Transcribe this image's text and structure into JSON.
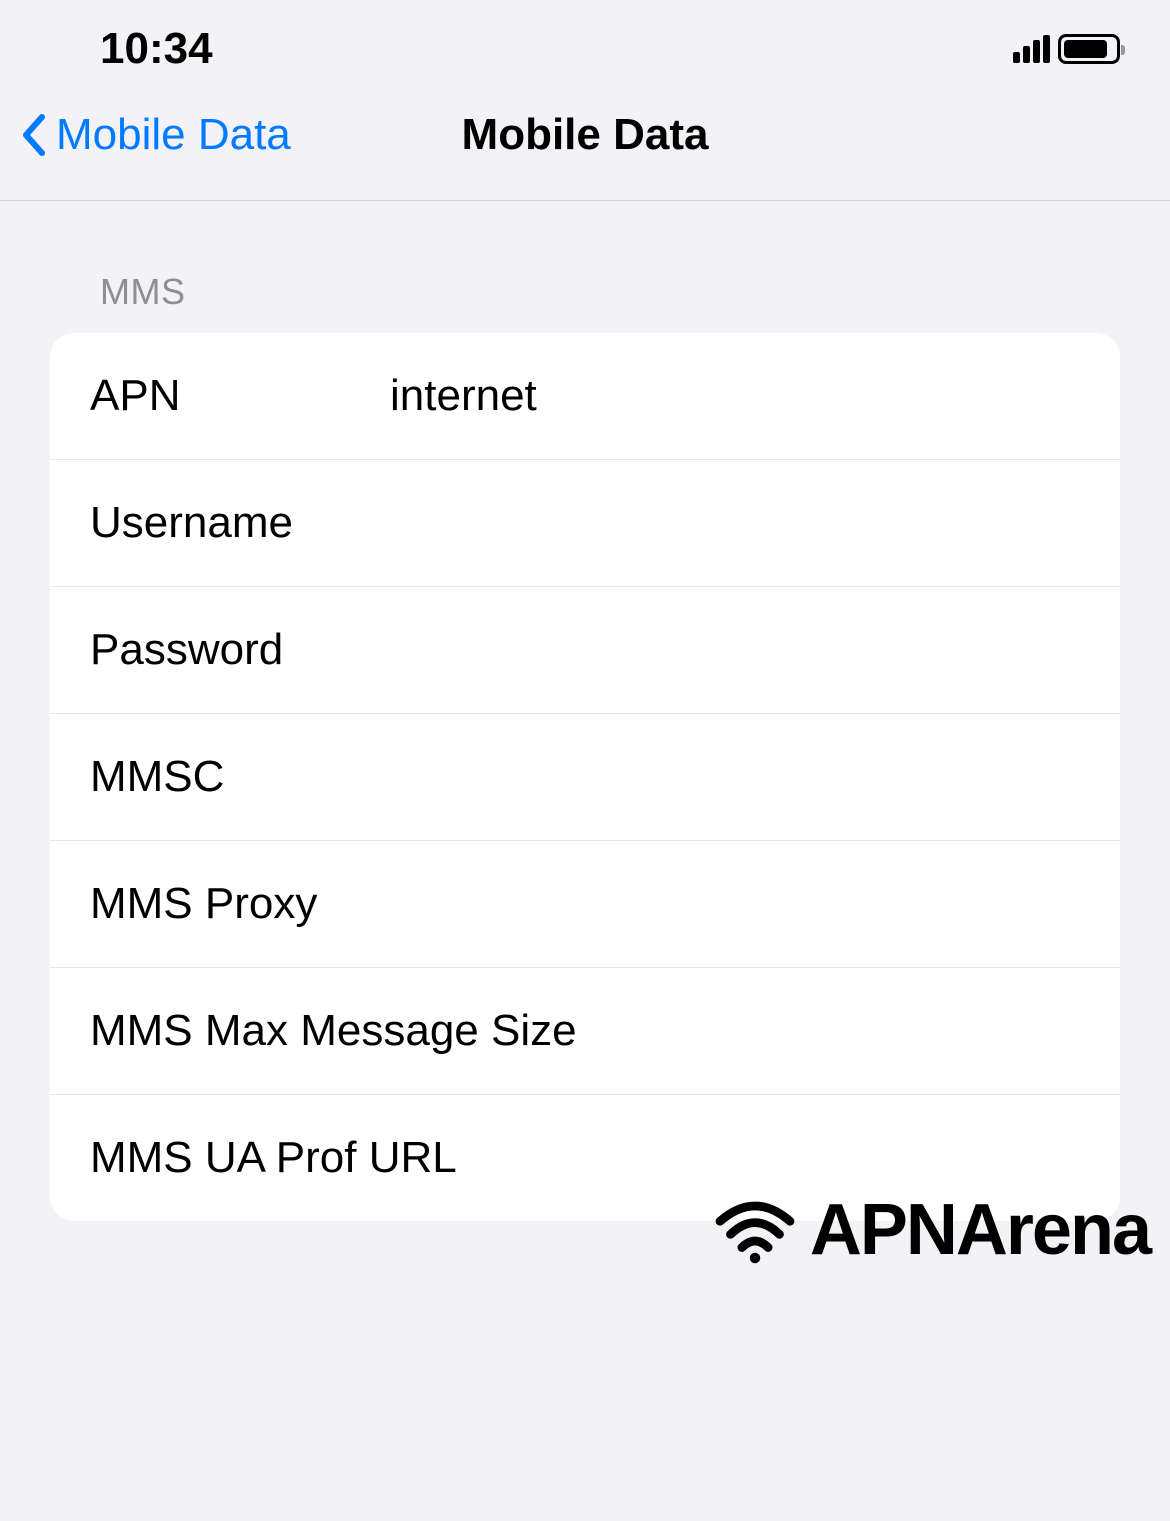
{
  "statusBar": {
    "time": "10:34"
  },
  "navBar": {
    "backLabel": "Mobile Data",
    "title": "Mobile Data"
  },
  "section": {
    "header": "MMS",
    "rows": [
      {
        "label": "APN",
        "value": "internet"
      },
      {
        "label": "Username",
        "value": ""
      },
      {
        "label": "Password",
        "value": ""
      },
      {
        "label": "MMSC",
        "value": ""
      },
      {
        "label": "MMS Proxy",
        "value": ""
      },
      {
        "label": "MMS Max Message Size",
        "value": ""
      },
      {
        "label": "MMS UA Prof URL",
        "value": ""
      }
    ]
  },
  "watermark": {
    "text": "APNArena"
  }
}
